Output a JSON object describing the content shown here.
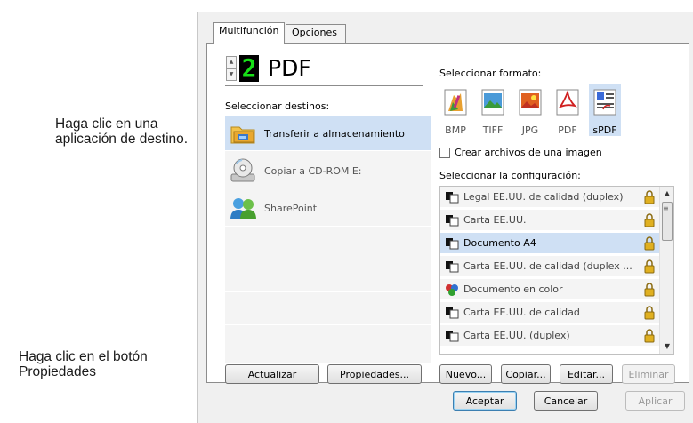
{
  "callouts": {
    "select_destination": "Haga clic en una aplicación de destino.",
    "properties_button": "Haga clic en el botón Propiedades"
  },
  "tabs": [
    {
      "label": "Multifunción",
      "active": true
    },
    {
      "label": "Opciones",
      "active": false
    }
  ],
  "selector": {
    "number": "2",
    "title": "PDF"
  },
  "destinations": {
    "label": "Seleccionar destinos:",
    "items": [
      {
        "label": "Transferir a almacenamiento",
        "icon": "folder-storage-icon",
        "selected": true
      },
      {
        "label": "Copiar a CD-ROM  E:",
        "icon": "cd-rom-icon",
        "selected": false
      },
      {
        "label": "SharePoint",
        "icon": "sharepoint-icon",
        "selected": false
      }
    ],
    "refresh_label": "Actualizar",
    "properties_label": "Propiedades..."
  },
  "formats": {
    "label": "Seleccionar formato:",
    "items": [
      {
        "label": "BMP",
        "icon": "bmp-icon",
        "selected": false
      },
      {
        "label": "TIFF",
        "icon": "tiff-icon",
        "selected": false
      },
      {
        "label": "JPG",
        "icon": "jpg-icon",
        "selected": false
      },
      {
        "label": "PDF",
        "icon": "pdf-icon",
        "selected": false
      },
      {
        "label": "sPDF",
        "icon": "spdf-icon",
        "selected": true
      }
    ],
    "single_image_label": "Crear archivos de una imagen",
    "single_image_checked": false
  },
  "configurations": {
    "label": "Seleccionar la configuración:",
    "items": [
      {
        "label": "Legal EE.UU. de calidad (duplex)",
        "selected": false
      },
      {
        "label": "Carta EE.UU.",
        "selected": false
      },
      {
        "label": "Documento A4",
        "selected": true
      },
      {
        "label": "Carta EE.UU. de calidad (duplex ...",
        "selected": false
      },
      {
        "label": "Documento en color",
        "selected": false,
        "color_icon": true
      },
      {
        "label": "Carta EE.UU. de calidad",
        "selected": false
      },
      {
        "label": "Carta EE.UU. (duplex)",
        "selected": false
      }
    ],
    "new_label": "Nuevo...",
    "copy_label": "Copiar...",
    "edit_label": "Editar...",
    "delete_label": "Eliminar"
  },
  "footer": {
    "accept_label": "Aceptar",
    "cancel_label": "Cancelar",
    "apply_label": "Aplicar"
  },
  "colors": {
    "selection": "#cfe0f4",
    "list_bg": "#f4f4f4",
    "digit": "#18e018",
    "lock": "#e0b020"
  }
}
